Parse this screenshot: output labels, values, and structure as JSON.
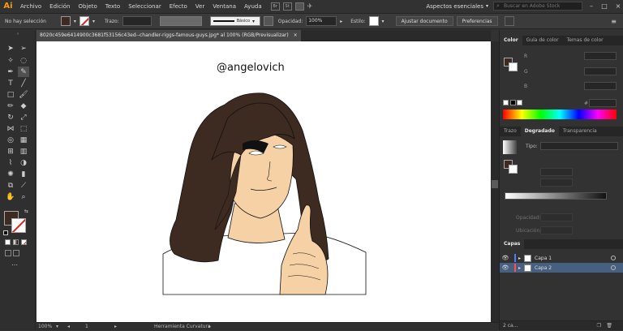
{
  "app": {
    "logo": "Ai"
  },
  "menu": [
    "Archivo",
    "Edición",
    "Objeto",
    "Texto",
    "Seleccionar",
    "Efecto",
    "Ver",
    "Ventana",
    "Ayuda"
  ],
  "menu_right": {
    "workspace": "Aspectos esenciales",
    "search_placeholder": "Buscar en Adobe Stock"
  },
  "control_bar": {
    "selection": "No hay selección",
    "stroke_label": "Trazo:",
    "brush_label": "Básico",
    "opacity_label": "Opacidad:",
    "opacity_value": "100%",
    "style_label": "Estilo:",
    "adjust_button": "Ajustar documento",
    "prefs_button": "Preferencias"
  },
  "document": {
    "tab_title": "8020c459e6414900c3681f53156c43ed--chandler-riggs-famous-guys.jpg* al 100% (RGB/Previsualizar)",
    "close_glyph": "×",
    "artwork_text": "@angelovich"
  },
  "status": {
    "zoom": "100%",
    "page": "1",
    "tool": "Herramienta Curvatura"
  },
  "color_panel": {
    "tabs": [
      "Color",
      "Guía de color",
      "Temas de color"
    ],
    "channels": [
      "R",
      "G",
      "B"
    ],
    "hex_prefix": "#"
  },
  "gradient_panel": {
    "tabs": [
      "Trazo",
      "Degradado",
      "Transparencia"
    ],
    "type_label": "Tipo:",
    "opacity_label": "Opacidad:",
    "location_label": "Ubicación:"
  },
  "layers_panel": {
    "title": "Capas",
    "layers": [
      {
        "name": "Capa 1",
        "color": "#4f7cff"
      },
      {
        "name": "Capa 2",
        "color": "#ff4f4f"
      }
    ],
    "footer": "2 ca..."
  },
  "colors": {
    "hair": "#3d2a20",
    "skin": "#f6d1a6",
    "fill_swatch": "#3d2a20",
    "accent": "#ff9a00"
  },
  "icons": {
    "selection": "selection-arrow-icon",
    "direct_selection": "direct-selection-icon",
    "magic_wand": "magic-wand-icon",
    "lasso": "lasso-icon",
    "pen": "pen-icon",
    "curvature": "curvature-icon",
    "type": "type-icon",
    "line": "line-segment-icon",
    "rectangle": "rectangle-icon",
    "paintbrush": "paintbrush-icon",
    "pencil": "pencil-icon",
    "eraser": "eraser-icon",
    "rotate": "rotate-icon",
    "scale": "scale-icon",
    "width": "width-icon",
    "free_transform": "free-transform-icon",
    "shape_builder": "shape-builder-icon",
    "perspective": "perspective-grid-icon",
    "mesh": "mesh-icon",
    "gradient": "gradient-tool-icon",
    "eyedropper": "eyedropper-icon",
    "blend": "blend-icon",
    "symbol_sprayer": "symbol-sprayer-icon",
    "column_graph": "column-graph-icon",
    "artboard": "artboard-icon",
    "slice": "slice-icon",
    "hand": "hand-icon",
    "zoom": "zoom-icon"
  }
}
